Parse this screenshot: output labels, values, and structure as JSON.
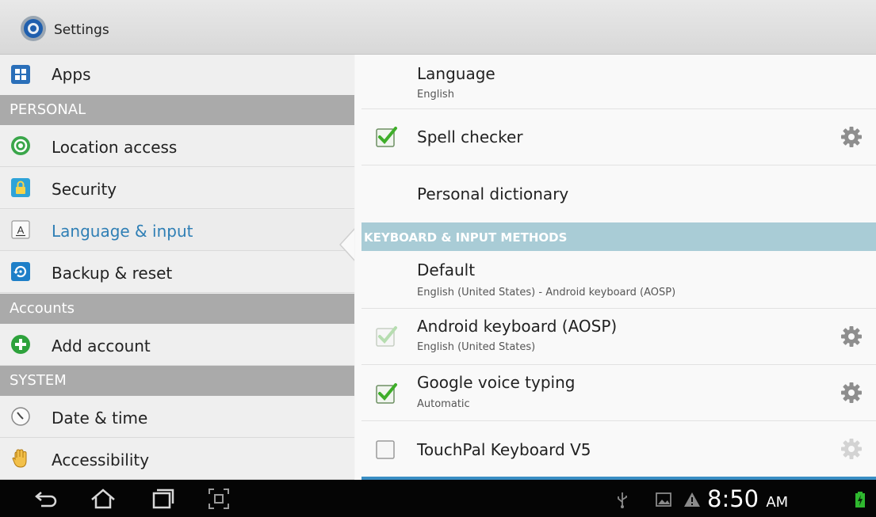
{
  "actionbar": {
    "title": "Settings"
  },
  "left": {
    "items": [
      {
        "type": "item",
        "label": "Apps",
        "icon": "apps-icon"
      },
      {
        "type": "header",
        "label": "PERSONAL"
      },
      {
        "type": "item",
        "label": "Location access",
        "icon": "location-icon"
      },
      {
        "type": "item",
        "label": "Security",
        "icon": "lock-icon"
      },
      {
        "type": "item",
        "label": "Language & input",
        "icon": "keyboard-letter-icon",
        "active": true
      },
      {
        "type": "item",
        "label": "Backup & reset",
        "icon": "backup-icon"
      },
      {
        "type": "header",
        "label": "Accounts"
      },
      {
        "type": "item",
        "label": "Add account",
        "icon": "add-icon"
      },
      {
        "type": "header",
        "label": "SYSTEM"
      },
      {
        "type": "item",
        "label": "Date & time",
        "icon": "clock-icon"
      },
      {
        "type": "item",
        "label": "Accessibility",
        "icon": "hand-icon"
      }
    ]
  },
  "right": {
    "language": {
      "title": "Language",
      "value": "English"
    },
    "spell_checker": {
      "title": "Spell checker",
      "checked": true
    },
    "personal_dictionary": {
      "title": "Personal dictionary"
    },
    "keyboard_header": "KEYBOARD & INPUT METHODS",
    "default": {
      "title": "Default",
      "value": "English (United States) - Android keyboard (AOSP)"
    },
    "android_keyboard": {
      "title": "Android keyboard (AOSP)",
      "value": "English (United States)",
      "checked": true,
      "disabled": true
    },
    "google_voice": {
      "title": "Google voice typing",
      "value": "Automatic",
      "checked": true
    },
    "touchpal": {
      "title": "TouchPal Keyboard V5",
      "checked": false
    }
  },
  "statusbar": {
    "time": "8:50",
    "ampm": "AM"
  },
  "colors": {
    "accent_text": "#2f7fb5",
    "section_header": "#aaaaaa",
    "keyboard_header": "#a9ccd6",
    "check_green": "#3fae2a"
  }
}
